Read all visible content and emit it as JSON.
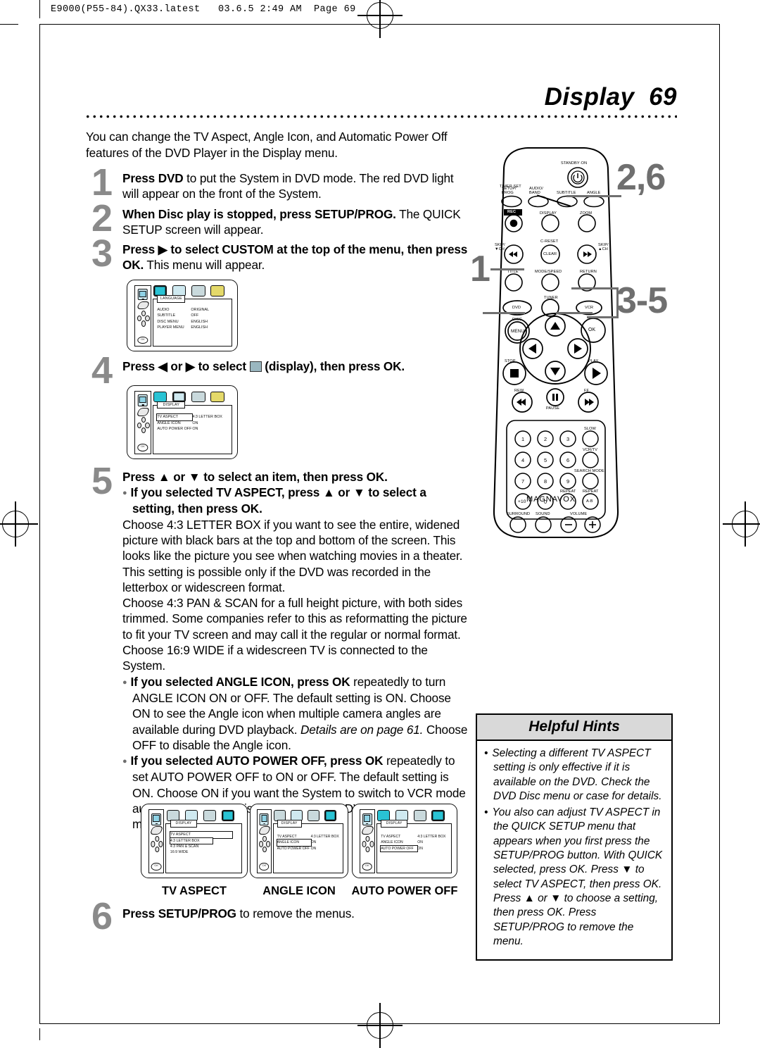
{
  "print_slug": "E9000(P55-84).QX33.latest   03.6.5 2:49 AM  Page 69",
  "page": {
    "title": "Display",
    "page_number": "69"
  },
  "intro": "You can change the TV Aspect, Angle Icon, and Automatic Power Off features of the DVD Player in the Display menu.",
  "steps": [
    {
      "number": "1",
      "bold": "Press DVD",
      "rest": " to put the System in DVD mode. The red DVD light will appear on the front of the System."
    },
    {
      "number": "2",
      "bold": "When Disc play is stopped, press SETUP/PROG.",
      "rest": " The QUICK SETUP screen will appear."
    },
    {
      "number": "3",
      "bold": "Press ▶ to select CUSTOM at the top of the menu, then press OK.",
      "rest": " This menu will appear."
    },
    {
      "number": "4",
      "bold": "Press ◀ or ▶ to select",
      "rest": "(display), then press OK."
    },
    {
      "number": "5",
      "lead": "Press ▲ or ▼ to select an item, then press OK.",
      "bullets": [
        {
          "bold": "If you selected TV ASPECT, press ▲ or ▼ to select a setting, then press OK.",
          "body": "Choose 4:3 LETTER BOX if you want to see the entire, widened picture with black bars at the top and bottom of the screen. This looks like the picture you see when watching movies in a theater.  This setting is possible only if the DVD was recorded in the letterbox or widescreen format.\nChoose 4:3 PAN & SCAN for a full height picture, with both sides trimmed. Some companies refer to this as reformatting the picture to fit your TV screen and may call it the regular or normal format.\nChoose 16:9 WIDE if a widescreen TV is connected to the System."
        },
        {
          "bold": "If you selected ANGLE ICON, press OK",
          "body": " repeatedly to turn ANGLE ICON ON or OFF. The default setting is ON. Choose ON to see the Angle icon when multiple camera angles are available during DVD playback. ",
          "italic": "Details are on page 61.",
          "body2": " Choose OFF to disable the Angle icon."
        },
        {
          "bold": "If you selected AUTO POWER OFF, press OK",
          "body": " repeatedly to set AUTO POWER OFF to ON or OFF. The default setting is ON. Choose ON if you want the System to switch to VCR mode automatically if there is no activity at the DVD Player for 35 minutes."
        }
      ]
    },
    {
      "number": "6",
      "bold": "Press SETUP/PROG",
      "rest": " to remove the menus."
    }
  ],
  "tv_menus": {
    "language": {
      "tab_label": "LANGUAGE",
      "rows": [
        {
          "key": "AUDIO",
          "value": "ORIGINAL"
        },
        {
          "key": "SUBTITLE",
          "value": "OFF"
        },
        {
          "key": "DISC MENU",
          "value": "ENGLISH"
        },
        {
          "key": "PLAYER MENU",
          "value": "ENGLISH"
        }
      ],
      "ok_label": "OK"
    },
    "display_main": {
      "tab_label": "DISPLAY",
      "rows": [
        {
          "key": "TV ASPECT",
          "value": "4:3 LETTER BOX",
          "selected": true
        },
        {
          "key": "ANGLE ICON",
          "value": "ON"
        },
        {
          "key": "AUTO POWER OFF",
          "value": "ON"
        }
      ],
      "ok_label": "OK"
    },
    "tv_aspect": {
      "tab_label": "DISPLAY",
      "caption": "TV ASPECT",
      "rows": [
        {
          "key": "TV ASPECT",
          "value": "",
          "selected": true
        },
        {
          "key": "4:3 LETTER BOX",
          "value": ""
        },
        {
          "key": "4:3 PAN & SCAN",
          "value": ""
        },
        {
          "key": "16:9 WIDE",
          "value": ""
        }
      ],
      "ok_label": "OK"
    },
    "angle_icon": {
      "tab_label": "DISPLAY",
      "caption": "ANGLE ICON",
      "rows": [
        {
          "key": "TV ASPECT",
          "value": "4:3 LETTER BOX"
        },
        {
          "key": "ANGLE ICON",
          "value": "ON",
          "selected": true
        },
        {
          "key": "AUTO POWER OFF",
          "value": "ON"
        }
      ],
      "ok_label": "OK"
    },
    "auto_power_off": {
      "tab_label": "DISPLAY",
      "caption": "AUTO POWER OFF",
      "rows": [
        {
          "key": "TV ASPECT",
          "value": "4:3 LETTER BOX"
        },
        {
          "key": "ANGLE ICON",
          "value": "ON"
        },
        {
          "key": "AUTO POWER OFF",
          "value": "ON",
          "selected": true
        }
      ],
      "ok_label": "OK"
    }
  },
  "hints": {
    "heading": "Helpful Hints",
    "items": [
      "Selecting a different TV ASPECT setting is only effective if it is available on the DVD. Check the DVD Disc menu or case for details.",
      "You also can adjust TV ASPECT in the QUICK SETUP menu that appears when you first press the SETUP/PROG button. With QUICK selected, press OK. Press ▼ to select TV ASPECT, then press OK. Press ▲ or ▼ to choose a setting, then press OK. Press SETUP/PROG to remove the menu."
    ]
  },
  "remote": {
    "brand": "MAGNAVOX",
    "callouts": [
      {
        "id": "callout-2-6",
        "label": "2,6"
      },
      {
        "id": "callout-1",
        "label": "1"
      },
      {
        "id": "callout-3-5",
        "label": "3-5"
      }
    ],
    "buttons": {
      "timer_set": "TIMER SET",
      "standby_on": "STANDBY·ON",
      "setup_prog": "SETUP/\nPROG",
      "audio_band": "AUDIO/\nBAND",
      "subtitle": "SUBTITLE",
      "angle": "ANGLE",
      "rec": "REC",
      "display": "DISPLAY",
      "zoom": "ZOOM",
      "skip_down": "SKIP/\n▼CH",
      "c_reset": "C-RESET",
      "clear": "CLEAR",
      "skip_up": "SKIP/\n▲CH",
      "title": "TITLE",
      "mode_speed": "MODE/SPEED",
      "return": "RETURN",
      "tuner": "TUNER",
      "dvd": "DVD",
      "vcr": "VCR",
      "disc": "DISC",
      "menu": "MENU",
      "ok": "OK",
      "stop": "STOP",
      "play": "PLAY",
      "rew": "REW",
      "pause": "PAUSE",
      "ff": "FF",
      "slow": "SLOW",
      "vcr_tv": "VCR/TV",
      "search_mode": "SEARCH MODE",
      "repeat": "REPEAT",
      "repeat_ab": "REPEAT",
      "repeat_ab_btn": "A-B",
      "surround": "SURROUND",
      "sound": "SOUND",
      "volume": "VOLUME",
      "plus_ten": "+10",
      "numbers": [
        "1",
        "2",
        "3",
        "4",
        "5",
        "6",
        "7",
        "8",
        "9",
        "0"
      ]
    }
  }
}
